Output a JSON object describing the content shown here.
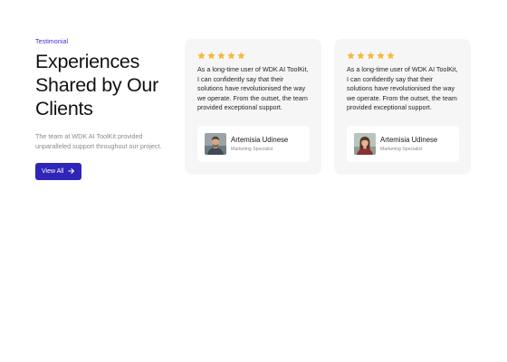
{
  "section": {
    "eyebrow": "Testimonial",
    "heading_line1": "Experiences",
    "heading_line2": "Shared by Our",
    "heading_line3": "Clients",
    "description": "The team at WDK AI ToolKit provided unparalleled support throughout our project.",
    "button_label": "View All"
  },
  "colors": {
    "accent": "#2f25b8",
    "star": "#f5b93a",
    "card_bg": "#f6f6f7"
  },
  "testimonials": [
    {
      "rating": 5,
      "quote": "As a long-time user of WDK AI ToolKit, I can confidently say that their solutions have revolutionised the way we operate. From the outset, the team provided exceptional support.",
      "name": "Artemisia Udinese",
      "role": "Marketing Specialist",
      "avatar_icon": "male-avatar"
    },
    {
      "rating": 5,
      "quote": "As a long-time user of WDK AI ToolKit, I can confidently say that their solutions have revolutionised the way we operate. From the outset, the team provided exceptional support.",
      "name": "Artemisia Udinese",
      "role": "Marketing Specialist",
      "avatar_icon": "female-avatar"
    }
  ]
}
